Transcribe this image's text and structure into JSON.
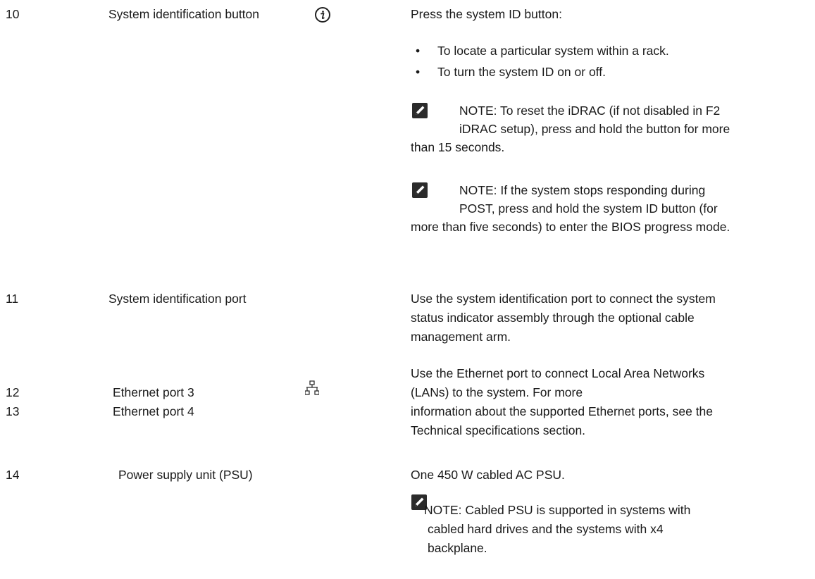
{
  "rows": [
    {
      "number": "10",
      "component": "System identification button",
      "icon": "info-icon",
      "description": "Press the system ID button:",
      "bullets": [
        "To locate a particular system within a rack.",
        "To turn the system ID on or off."
      ],
      "notes": [
        {
          "lines": [
            "NOTE: To reset the iDRAC (if not disabled in F2",
            "iDRAC setup), press and hold the button for more",
            "than 15 seconds."
          ]
        },
        {
          "lines": [
            "NOTE: If the system stops responding during",
            "POST, press and hold the system ID button (for",
            "more than five seconds) to enter the BIOS progress mode."
          ]
        }
      ]
    },
    {
      "number": "11",
      "component": "System identification port",
      "description_lines": [
        "Use the system identification port to connect the system",
        "status indicator assembly through the optional cable",
        "management arm."
      ]
    },
    {
      "number": "12",
      "component": "Ethernet port 3",
      "icon": "network-icon"
    },
    {
      "number": "13",
      "component": "Ethernet port 4"
    },
    {
      "ethernet_description_lines": [
        "Use the Ethernet port to connect Local Area Networks",
        "(LANs) to the system. For more",
        "information about the supported Ethernet ports, see the",
        "Technical specifications section."
      ]
    },
    {
      "number": "14",
      "component": "Power supply unit (PSU)",
      "description": "One 450 W cabled AC PSU.",
      "note_lines": [
        "NOTE: Cabled PSU is supported in systems with",
        "cabled hard drives and the systems with x4",
        "backplane."
      ]
    }
  ]
}
